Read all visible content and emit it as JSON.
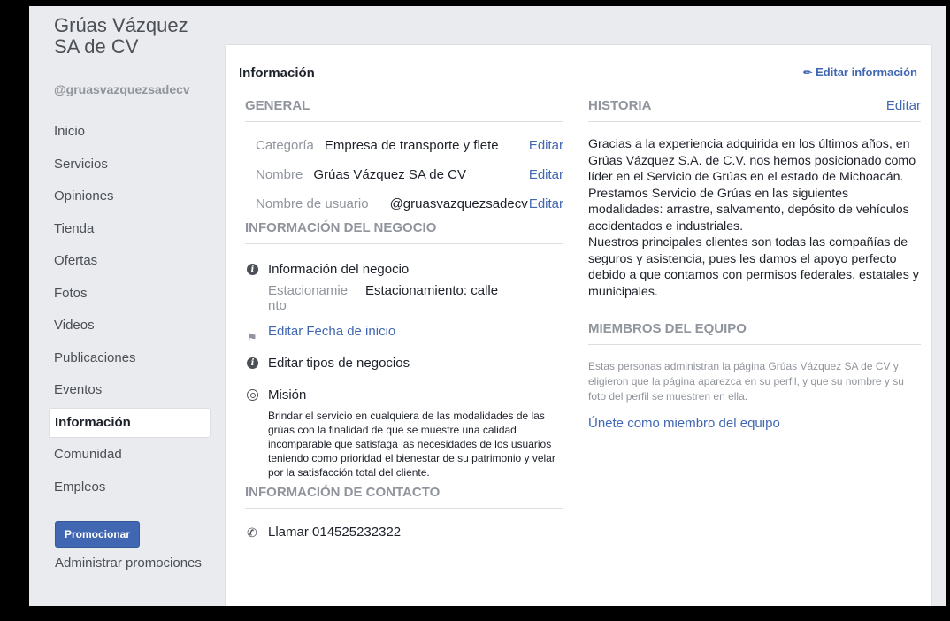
{
  "sidebar": {
    "page_name": "Grúas Vázquez SA de CV",
    "username": "@gruasvazquezsadecv",
    "items": [
      {
        "label": "Inicio",
        "active": false
      },
      {
        "label": "Servicios",
        "active": false
      },
      {
        "label": "Opiniones",
        "active": false
      },
      {
        "label": "Tienda",
        "active": false
      },
      {
        "label": "Ofertas",
        "active": false
      },
      {
        "label": "Fotos",
        "active": false
      },
      {
        "label": "Videos",
        "active": false
      },
      {
        "label": "Publicaciones",
        "active": false
      },
      {
        "label": "Eventos",
        "active": false
      },
      {
        "label": "Información",
        "active": true
      },
      {
        "label": "Comunidad",
        "active": false
      },
      {
        "label": "Empleos",
        "active": false
      }
    ],
    "promote_label": "Promocionar",
    "manage_promotions_label": "Administrar promociones"
  },
  "main": {
    "title": "Información",
    "edit_info_label": "Editar información",
    "general": {
      "heading": "GENERAL",
      "rows": [
        {
          "key": "Categoría",
          "value": "Empresa de transporte y flete",
          "edit": "Editar"
        },
        {
          "key": "Nombre",
          "value": "Grúas Vázquez SA de CV",
          "edit": "Editar"
        },
        {
          "key": "Nombre de usuario",
          "value": "@gruasvazquezsadecv",
          "edit": "Editar"
        }
      ]
    },
    "business": {
      "heading": "INFORMACIÓN DEL NEGOCIO",
      "info_label": "Información del negocio",
      "parking_key": "Estacionamiento",
      "parking_value": "Estacionamiento: calle",
      "start_date_link": "Editar Fecha de inicio",
      "business_types_label": "Editar tipos de negocios",
      "mission_label": "Misión",
      "mission_text": "Brindar el servicio en cualquiera de las modalidades de las grúas con la finalidad de que se muestre una calidad incomparable que satisfaga las necesidades de los usuarios teniendo como prioridad el bienestar de su patrimonio y velar por la satisfacción total del cliente."
    },
    "contact": {
      "heading": "INFORMACIÓN DE CONTACTO",
      "phone": "Llamar 014525232322"
    },
    "history": {
      "heading": "HISTORIA",
      "edit": "Editar",
      "text": "Gracias a la experiencia adquirida en los últimos años, en Grúas Vázquez S.A. de C.V. nos hemos posicionado como líder en el Servicio de Grúas en el estado de Michoacán. Prestamos Servicio de Grúas en las siguientes modalidades: arrastre, salvamento, depósito de vehículos accidentados e industriales.\nNuestros principales clientes son todas las compañías de seguros y asistencia, pues les damos el apoyo perfecto debido a que contamos con permisos federales, estatales y municipales."
    },
    "team": {
      "heading": "MIEMBROS DEL EQUIPO",
      "text": "Estas personas administran la página Grúas Vázquez SA de CV y eligieron que la página aparezca en su perfil, y que su nombre y su foto del perfil se muestren en ella.",
      "join_label": "Únete como miembro del equipo"
    }
  },
  "colors": {
    "brand_blue": "#4267b2",
    "background": "#e9ebee",
    "muted_text": "#90949c"
  }
}
